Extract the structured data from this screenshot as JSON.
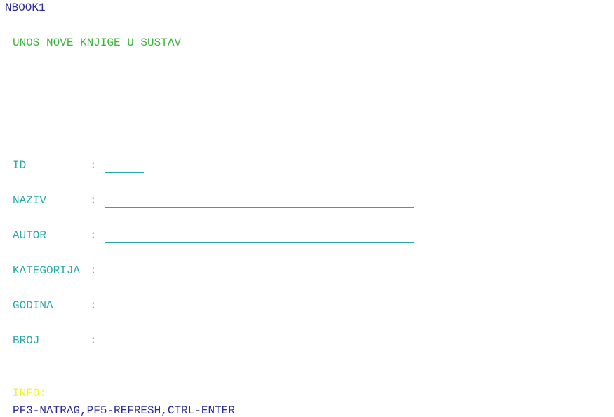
{
  "screen_id": "NBOOK1",
  "title": "UNOS NOVE KNJIGE U SUSTAV",
  "fields": {
    "id": {
      "label": "ID",
      "separator": ":",
      "value": ""
    },
    "naziv": {
      "label": "NAZIV",
      "separator": ":",
      "value": ""
    },
    "autor": {
      "label": "AUTOR",
      "separator": ":",
      "value": ""
    },
    "kategorija": {
      "label": "KATEGORIJA",
      "separator": ":",
      "value": ""
    },
    "godina": {
      "label": "GODINA",
      "separator": ":",
      "value": ""
    },
    "broj": {
      "label": "BROJ",
      "separator": ":",
      "value": ""
    }
  },
  "info": {
    "label": "INFO:",
    "keys": "PF3-NATRAG,PF5-REFRESH,CTRL-ENTER"
  },
  "colors": {
    "screen_id": "#2b2b96",
    "title": "#3cb43c",
    "labels": "#26a8a8",
    "info_label": "#f4f41e",
    "keys": "#2b2b96",
    "background": "#ffffff"
  }
}
